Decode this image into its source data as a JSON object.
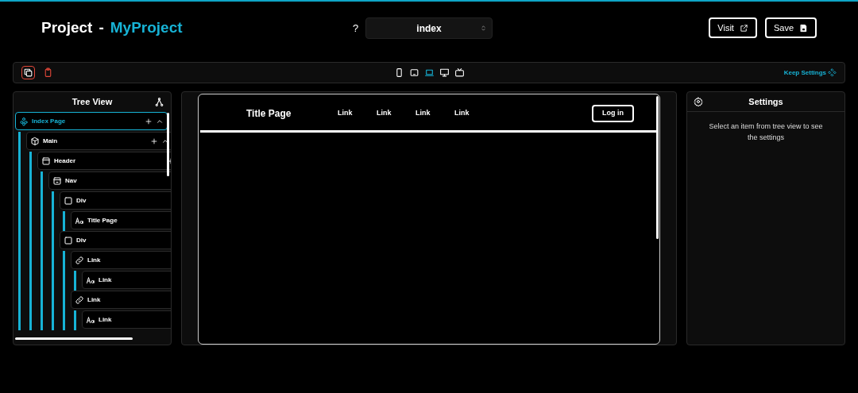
{
  "header": {
    "title": "Project",
    "separator": "-",
    "project": "MyProject",
    "help": "?",
    "page_select": "index",
    "buttons": [
      {
        "label": "Visit",
        "kind": "external"
      },
      {
        "label": "Save",
        "kind": "save"
      }
    ]
  },
  "toolbar": {
    "tools": [
      {
        "kind": "copy",
        "selected": true
      },
      {
        "kind": "clipboard",
        "selected": false
      }
    ],
    "devices": [
      {
        "kind": "phone",
        "selected": false
      },
      {
        "kind": "tablet",
        "selected": false
      },
      {
        "kind": "laptop",
        "selected": true
      },
      {
        "kind": "desktop",
        "selected": false
      },
      {
        "kind": "tv",
        "selected": false
      }
    ],
    "keep_settings": "Keep Settings"
  },
  "tree": {
    "title": "Tree View",
    "items": [
      {
        "label": "Index Page",
        "kind": "page",
        "selected": true,
        "expanded": true,
        "children": [
          {
            "label": "Main",
            "kind": "section",
            "selected": false,
            "expanded": true,
            "children": [
              {
                "label": "Header",
                "kind": "header",
                "selected": false,
                "children": [
                  {
                    "label": "Nav",
                    "kind": "nav",
                    "selected": false,
                    "children": [
                      {
                        "label": "Div",
                        "kind": "div",
                        "selected": false,
                        "children": [
                          {
                            "label": "Title Page",
                            "kind": "text",
                            "selected": false
                          }
                        ]
                      },
                      {
                        "label": "Div",
                        "kind": "div",
                        "selected": false,
                        "children": [
                          {
                            "label": "Link",
                            "kind": "link",
                            "selected": false,
                            "children": [
                              {
                                "label": "Link",
                                "kind": "text",
                                "selected": false
                              }
                            ]
                          },
                          {
                            "label": "Link",
                            "kind": "link",
                            "selected": false,
                            "children": [
                              {
                                "label": "Link",
                                "kind": "text",
                                "selected": false
                              }
                            ]
                          }
                        ]
                      }
                    ]
                  }
                ]
              }
            ]
          }
        ]
      }
    ]
  },
  "preview": {
    "title": "Title Page",
    "links": [
      "Link",
      "Link",
      "Link",
      "Link"
    ],
    "login": "Log in"
  },
  "settings": {
    "title": "Settings",
    "message": "Select an item from tree view to see the settings"
  }
}
